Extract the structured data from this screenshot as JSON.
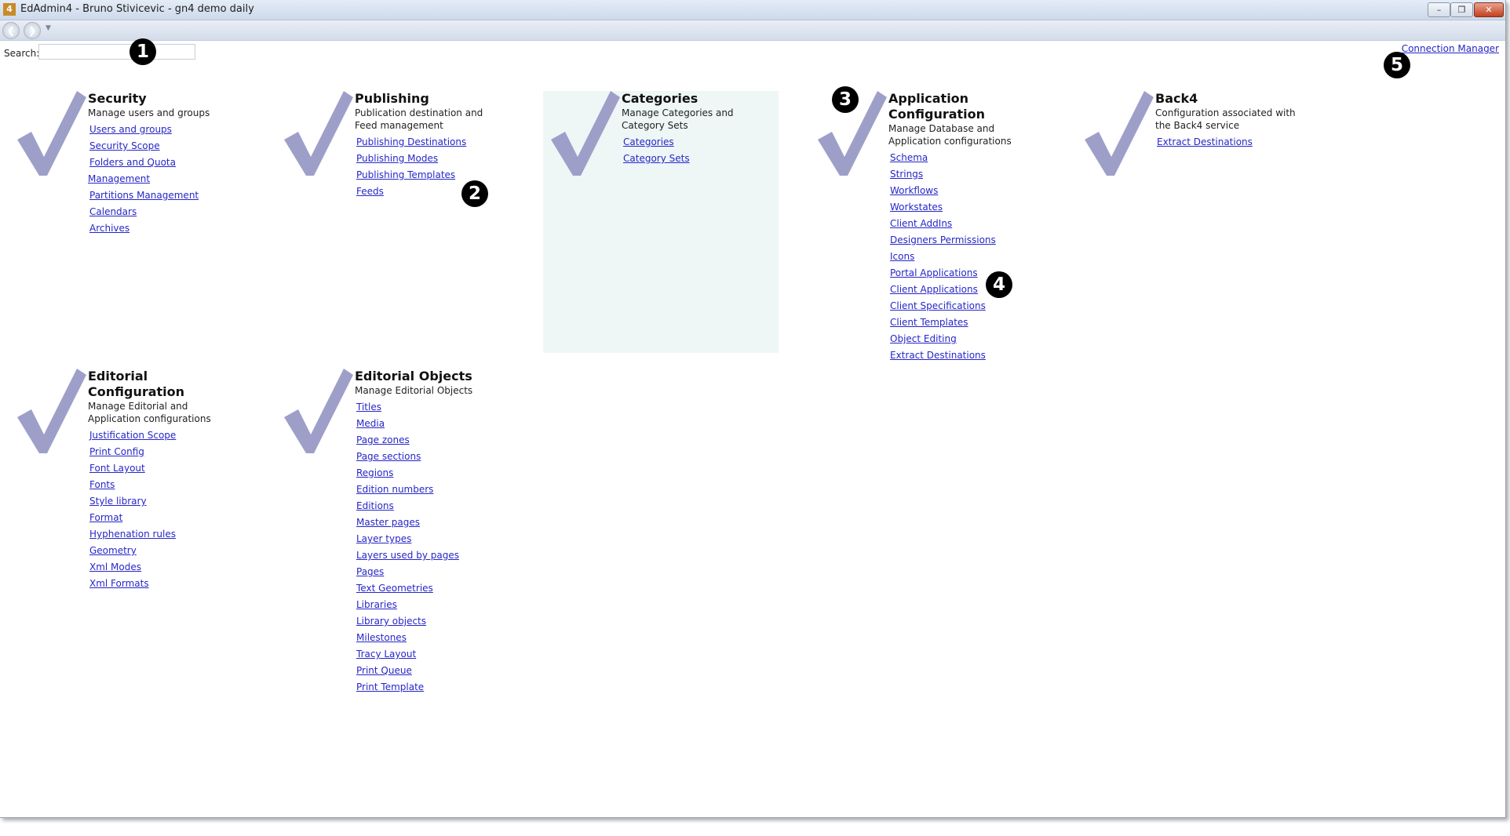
{
  "window": {
    "title": "EdAdmin4 - Bruno Stivicevic - gn4 demo daily",
    "app_icon_letter": "4"
  },
  "search": {
    "label": "Search:",
    "value": "",
    "placeholder": ""
  },
  "connection_manager": "Connection Manager",
  "markers": [
    "1",
    "2",
    "3",
    "4",
    "5"
  ],
  "colors": {
    "link": "#2626c8",
    "checkmark": "#9e9fc9",
    "highlight_panel": "#eef6f6"
  },
  "panels": [
    {
      "title": "Security",
      "description": "Manage users and groups",
      "links": [
        "Users and groups",
        "Security Scope",
        "Folders and Quota Management",
        "Partitions Management",
        "Calendars",
        "Archives"
      ]
    },
    {
      "title": "Publishing",
      "description": "Publication destination and Feed management",
      "links": [
        "Publishing Destinations",
        "Publishing Modes",
        "Publishing Templates",
        "Feeds"
      ]
    },
    {
      "title": "Categories",
      "description": "Manage Categories and Category Sets",
      "links": [
        "Categories",
        "Category Sets"
      ]
    },
    {
      "title": "Application Configuration",
      "description": "Manage Database and Application configurations",
      "links": [
        "Schema",
        "Strings",
        "Workflows",
        "Workstates",
        "Client AddIns",
        "Designers Permissions",
        "Icons",
        "Portal Applications",
        "Client Applications",
        "Client Specifications",
        "Client Templates",
        "Object Editing",
        "Extract Destinations"
      ]
    },
    {
      "title": "Back4",
      "description": "Configuration associated with the Back4 service",
      "links": [
        "Extract Destinations"
      ]
    },
    {
      "title": "Editorial Configuration",
      "description": "Manage Editorial and Application configurations",
      "links": [
        "Justification Scope",
        "Print Config",
        "Font Layout",
        "Fonts",
        "Style library",
        "Format",
        "Hyphenation rules",
        "Geometry",
        "Xml Modes",
        "Xml Formats"
      ]
    },
    {
      "title": "Editorial Objects",
      "description": "Manage Editorial Objects",
      "links": [
        "Titles",
        "Media",
        "Page zones",
        "Page sections",
        "Regions",
        "Edition numbers",
        "Editions",
        "Master pages",
        "Layer types",
        "Layers used by pages",
        "Pages",
        "Text Geometries",
        "Libraries",
        "Library objects",
        "Milestones",
        "Tracy Layout",
        "Print Queue",
        "Print Template"
      ]
    }
  ]
}
